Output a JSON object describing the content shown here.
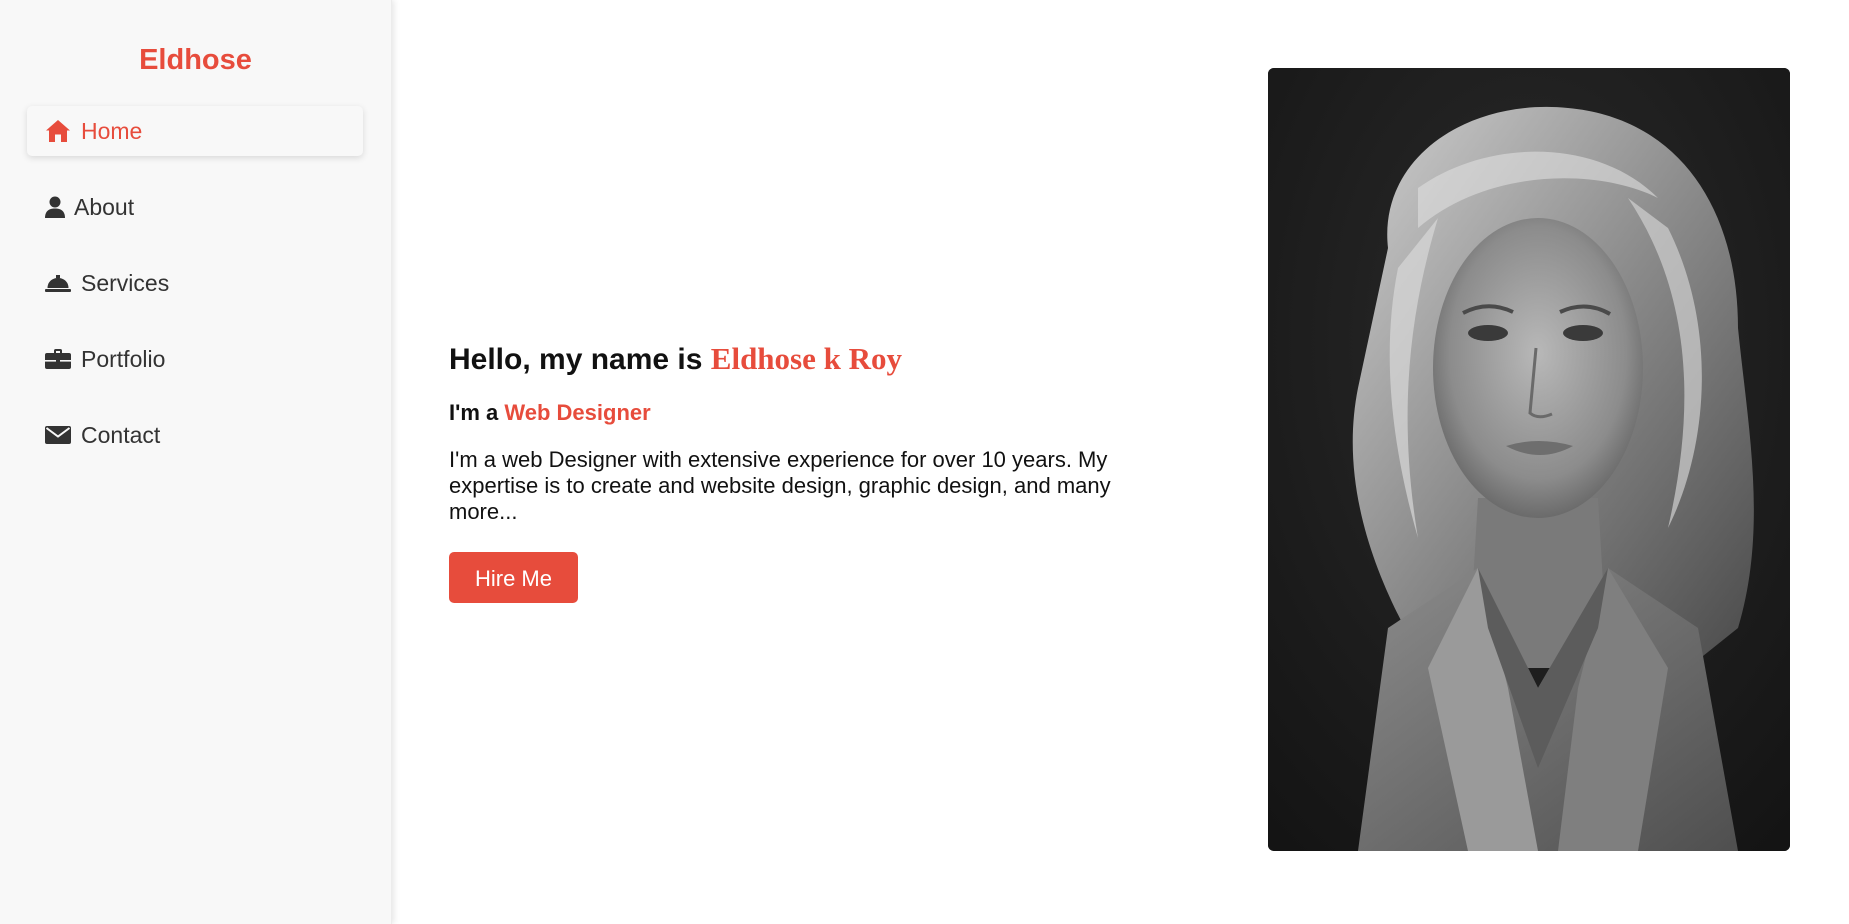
{
  "brand": {
    "name": "Eldhose",
    "accent_color": "#e74c3c"
  },
  "sidebar": {
    "items": [
      {
        "label": "Home",
        "icon": "home-icon",
        "active": true
      },
      {
        "label": "About",
        "icon": "user-icon",
        "active": false
      },
      {
        "label": "Services",
        "icon": "bell-icon",
        "active": false
      },
      {
        "label": "Portfolio",
        "icon": "briefcase-icon",
        "active": false
      },
      {
        "label": "Contact",
        "icon": "envelope-icon",
        "active": false
      }
    ]
  },
  "hero": {
    "greeting": "Hello, my name is",
    "name": "Eldhose k Roy",
    "role_prefix": "I'm a",
    "role": "Web Designer",
    "description": "I'm a web Designer with extensive experience for over 10 years. My expertise is to create and website design, graphic design, and many more...",
    "button_label": "Hire Me"
  },
  "portrait": {
    "icon": "portrait-photo"
  }
}
